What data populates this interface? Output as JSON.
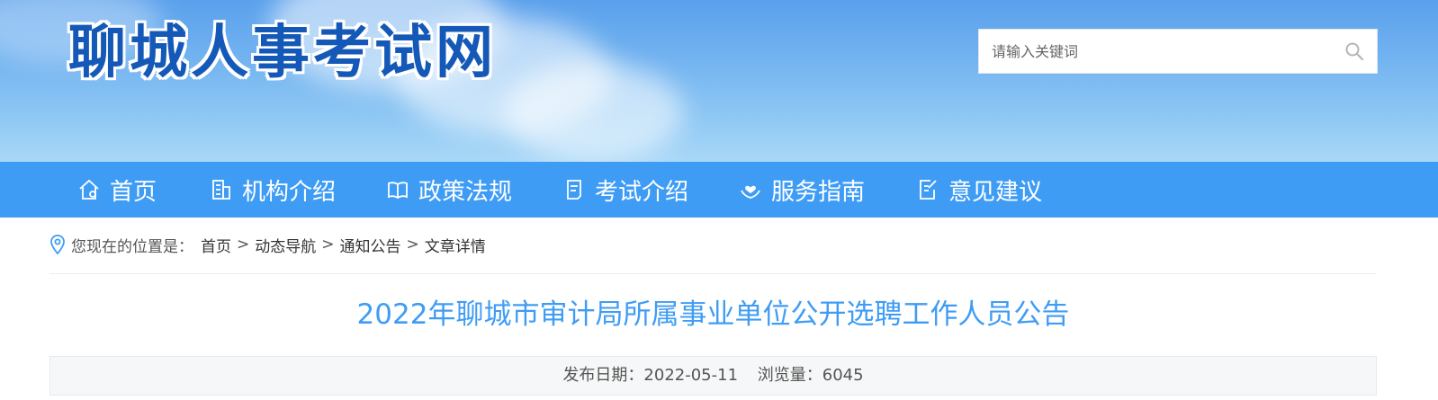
{
  "site": {
    "logo_text": "聊城人事考试网"
  },
  "search": {
    "placeholder": "请输入关键词",
    "icon": "search-icon"
  },
  "nav": {
    "items": [
      {
        "label": "首页",
        "icon": "home-icon"
      },
      {
        "label": "机构介绍",
        "icon": "building-icon"
      },
      {
        "label": "政策法规",
        "icon": "book-icon"
      },
      {
        "label": "考试介绍",
        "icon": "document-icon"
      },
      {
        "label": "服务指南",
        "icon": "heart-hands-icon"
      },
      {
        "label": "意见建议",
        "icon": "edit-icon"
      }
    ]
  },
  "breadcrumb": {
    "label": "您现在的位置是：",
    "items": [
      "首页",
      "动态导航",
      "通知公告",
      "文章详情"
    ],
    "separator": ">"
  },
  "article": {
    "title": "2022年聊城市审计局所属事业单位公开选聘工作人员公告",
    "date_label": "发布日期：",
    "date": "2022-05-11",
    "views_label": "浏览量：",
    "views": "6045"
  },
  "colors": {
    "accent": "#3f9cf5",
    "logo": "#1559b8",
    "banner_top": "#5aa0ec"
  }
}
